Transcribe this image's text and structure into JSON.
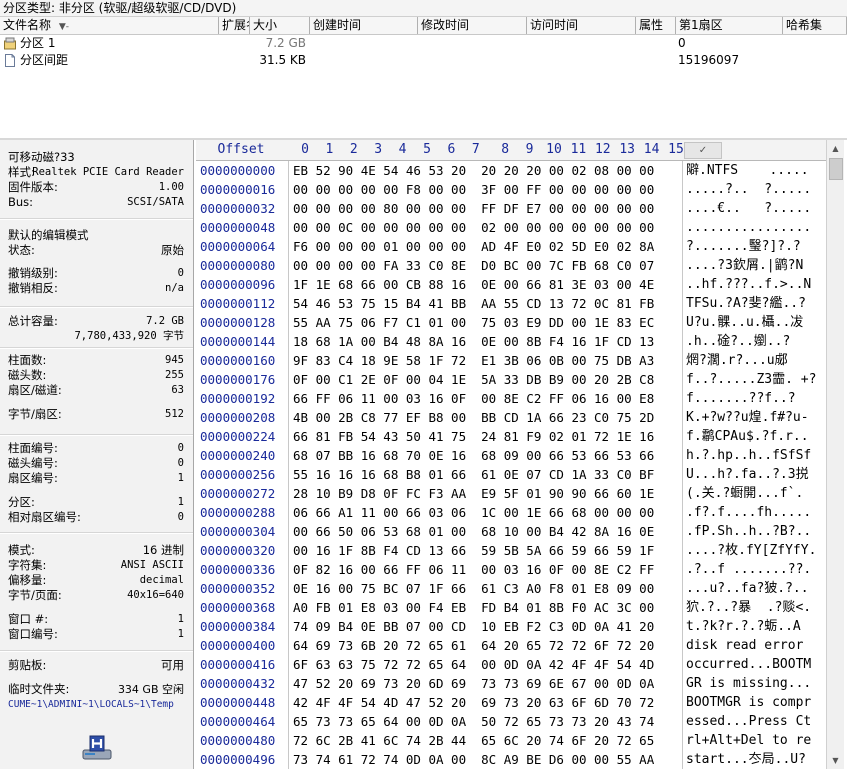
{
  "title_bar": "分区类型: 非分区 (软驱/超级软驱/CD/DVD)",
  "file_list": {
    "columns": [
      "文件名称",
      "扩展名",
      "大小",
      "创建时间",
      "修改时间",
      "访问时间",
      "属性",
      "第1扇区",
      "哈希集"
    ],
    "rows": [
      {
        "name": "分区 1",
        "size": "7.2 GB",
        "first_sector": "0"
      },
      {
        "name": "分区间距",
        "size": "31.5 KB",
        "first_sector": "15196097"
      }
    ]
  },
  "info_panel": {
    "device": "可移动磁?33",
    "model_label": "样式:",
    "model_value": "Realtek PCIE Card Reader",
    "firmware_label": "固件版本:",
    "firmware_value": "1.00",
    "bus_label": "Bus:",
    "bus_value": "SCSI/SATA",
    "edit_mode_label": "默认的编辑模式",
    "state_label": "状态:",
    "state_value": "原始",
    "undo_level_label": "撤销级别:",
    "undo_level_value": "0",
    "undo_reverse_label": "撤销相反:",
    "undo_reverse_value": "n/a",
    "total_capacity_label": "总计容量:",
    "total_capacity_value": "7.2 GB",
    "total_bytes_value": "7,780,433,920 字节",
    "cylinders_label": "柱面数:",
    "cylinders_value": "945",
    "heads_label": "磁头数:",
    "heads_value": "255",
    "sectors_track_label": "扇区/磁道:",
    "sectors_track_value": "63",
    "bytes_sector_label": "字节/扇区:",
    "bytes_sector_value": "512",
    "cyl_no_label": "柱面编号:",
    "cyl_no_value": "0",
    "head_no_label": "磁头编号:",
    "head_no_value": "0",
    "sector_no_label": "扇区编号:",
    "sector_no_value": "1",
    "partition_label": "分区:",
    "partition_value": "1",
    "rel_sector_label": "相对扇区编号:",
    "rel_sector_value": "0",
    "mode_label": "模式:",
    "mode_value": "16 进制",
    "charset_label": "字符集:",
    "charset_value": "ANSI ASCII",
    "offset_label": "偏移量:",
    "offset_value": "decimal",
    "bytes_page_label": "字节/页面:",
    "bytes_page_value": "40x16=640",
    "window_label": "窗口 #:",
    "window_value": "1",
    "window_no_label": "窗口编号:",
    "window_no_value": "1",
    "clipboard_label": "剪贴板:",
    "clipboard_value": "可用",
    "temp_label": "临时文件夹:",
    "temp_value": "334 GB 空闲",
    "temp_path": "CUME~1\\ADMINI~1\\LOCALS~1\\Temp"
  },
  "hex_view": {
    "offset_header": "Offset",
    "col_headers": [
      "0",
      "1",
      "2",
      "3",
      "4",
      "5",
      "6",
      "7",
      "8",
      "9",
      "10",
      "11",
      "12",
      "13",
      "14",
      "15"
    ],
    "rows": [
      {
        "offset": "0000000000",
        "hex": "EB 52 90 4E 54 46 53 20  20 20 20 00 02 08 00 00",
        "text": "隦.NTFS    ....."
      },
      {
        "offset": "0000000016",
        "hex": "00 00 00 00 00 F8 00 00  3F 00 FF 00 00 00 00 00",
        "text": ".....?..  ?....."
      },
      {
        "offset": "0000000032",
        "hex": "00 00 00 00 80 00 00 00  FF DF E7 00 00 00 00 00",
        "text": "....€..   ?....."
      },
      {
        "offset": "0000000048",
        "hex": "00 00 0C 00 00 00 00 00  02 00 00 00 00 00 00 00",
        "text": "................"
      },
      {
        "offset": "0000000064",
        "hex": "F6 00 00 00 01 00 00 00  AD 4F E0 02 5D E0 02 8A",
        "text": "?.......瑿?]?.?"
      },
      {
        "offset": "0000000080",
        "hex": "00 00 00 00 FA 33 C0 8E  D0 BC 00 7C FB 68 C0 07",
        "text": "....?3欽屑.|鹠?N"
      },
      {
        "offset": "0000000096",
        "hex": "1F 1E 68 66 00 CB 88 16  0E 00 66 81 3E 03 00 4E",
        "text": "..hf.???..f.>..N"
      },
      {
        "offset": "0000000112",
        "hex": "54 46 53 75 15 B4 41 BB  AA 55 CD 13 72 0C 81 FB",
        "text": "TFSu.?A?斐?繿..?"
      },
      {
        "offset": "0000000128",
        "hex": "55 AA 75 06 F7 C1 01 00  75 03 E9 DD 00 1E 83 EC",
        "text": "U?u.髁..u.欇..冹"
      },
      {
        "offset": "0000000144",
        "hex": "18 68 1A 00 B4 48 8A 16  0E 00 8B F4 16 1F CD 13",
        "text": ".h..碒?..嬼..?"
      },
      {
        "offset": "0000000160",
        "hex": "9F 83 C4 18 9E 58 1F 72  E1 3B 06 0B 00 75 DB A3",
        "text": "焹?濶.r?...u郕"
      },
      {
        "offset": "0000000176",
        "hex": "0F 00 C1 2E 0F 00 04 1E  5A 33 DB B9 00 20 2B C8",
        "text": "f..?.....Z3霝. +?"
      },
      {
        "offset": "0000000192",
        "hex": "66 FF 06 11 00 03 16 0F  00 8E C2 FF 06 16 00 E8",
        "text": "f.......??f..?"
      },
      {
        "offset": "0000000208",
        "hex": "4B 00 2B C8 77 EF B8 00  BB CD 1A 66 23 C0 75 2D",
        "text": "K.+?w??u煌.f#?u-"
      },
      {
        "offset": "0000000224",
        "hex": "66 81 FB 54 43 50 41 75  24 81 F9 02 01 72 1E 16",
        "text": "f.鹴CPAu$.?f.r.."
      },
      {
        "offset": "0000000240",
        "hex": "68 07 BB 16 68 70 0E 16  68 09 00 66 53 66 53 66",
        "text": "h.?.hp..h..fSfSf"
      },
      {
        "offset": "0000000256",
        "hex": "55 16 16 16 68 B8 01 66  61 0E 07 CD 1A 33 C0 BF",
        "text": "U...h?.fa..?.3捝"
      },
      {
        "offset": "0000000272",
        "hex": "28 10 B9 D8 0F FC F3 AA  E9 5F 01 90 90 66 60 1E",
        "text": "(.关.?蟵開...f`."
      },
      {
        "offset": "0000000288",
        "hex": "06 66 A1 11 00 66 03 06  1C 00 1E 66 68 00 00 00",
        "text": ".f?.f....fh....."
      },
      {
        "offset": "0000000304",
        "hex": "00 66 50 06 53 68 01 00  68 10 00 B4 42 8A 16 0E",
        "text": ".fP.Sh..h..?B?.."
      },
      {
        "offset": "0000000320",
        "hex": "00 16 1F 8B F4 CD 13 66  59 5B 5A 66 59 66 59 1F",
        "text": "....?枚.fY[ZfYfY."
      },
      {
        "offset": "0000000336",
        "hex": "0F 82 16 00 66 FF 06 11  00 03 16 0F 00 8E C2 FF",
        "text": ".?..f .......??."
      },
      {
        "offset": "0000000352",
        "hex": "0E 16 00 75 BC 07 1F 66  61 C3 A0 F8 01 E8 09 00",
        "text": "...u?..fa?狓.?.."
      },
      {
        "offset": "0000000368",
        "hex": "A0 FB 01 E8 03 00 F4 EB  FD B4 01 8B F0 AC 3C 00",
        "text": "狖.?..?暴  .?赕<."
      },
      {
        "offset": "0000000384",
        "hex": "74 09 B4 0E BB 07 00 CD  10 EB F2 C3 0D 0A 41 20",
        "text": "t.?k?r.?.?蛎..A "
      },
      {
        "offset": "0000000400",
        "hex": "64 69 73 6B 20 72 65 61  64 20 65 72 72 6F 72 20",
        "text": "disk read error "
      },
      {
        "offset": "0000000416",
        "hex": "6F 63 63 75 72 72 65 64  00 0D 0A 42 4F 4F 54 4D",
        "text": "occurred...BOOTM"
      },
      {
        "offset": "0000000432",
        "hex": "47 52 20 69 73 20 6D 69  73 73 69 6E 67 00 0D 0A",
        "text": "GR is missing..."
      },
      {
        "offset": "0000000448",
        "hex": "42 4F 4F 54 4D 47 52 20  69 73 20 63 6F 6D 70 72",
        "text": "BOOTMGR is compr"
      },
      {
        "offset": "0000000464",
        "hex": "65 73 73 65 64 00 0D 0A  50 72 65 73 73 20 43 74",
        "text": "essed...Press Ct"
      },
      {
        "offset": "0000000480",
        "hex": "72 6C 2B 41 6C 74 2B 44  65 6C 20 74 6F 20 72 65",
        "text": "rl+Alt+Del to re"
      },
      {
        "offset": "0000000496",
        "hex": "73 74 61 72 74 0D 0A 00  8C A9 BE D6 00 00 55 AA",
        "text": "start...冭局..U?"
      }
    ]
  }
}
